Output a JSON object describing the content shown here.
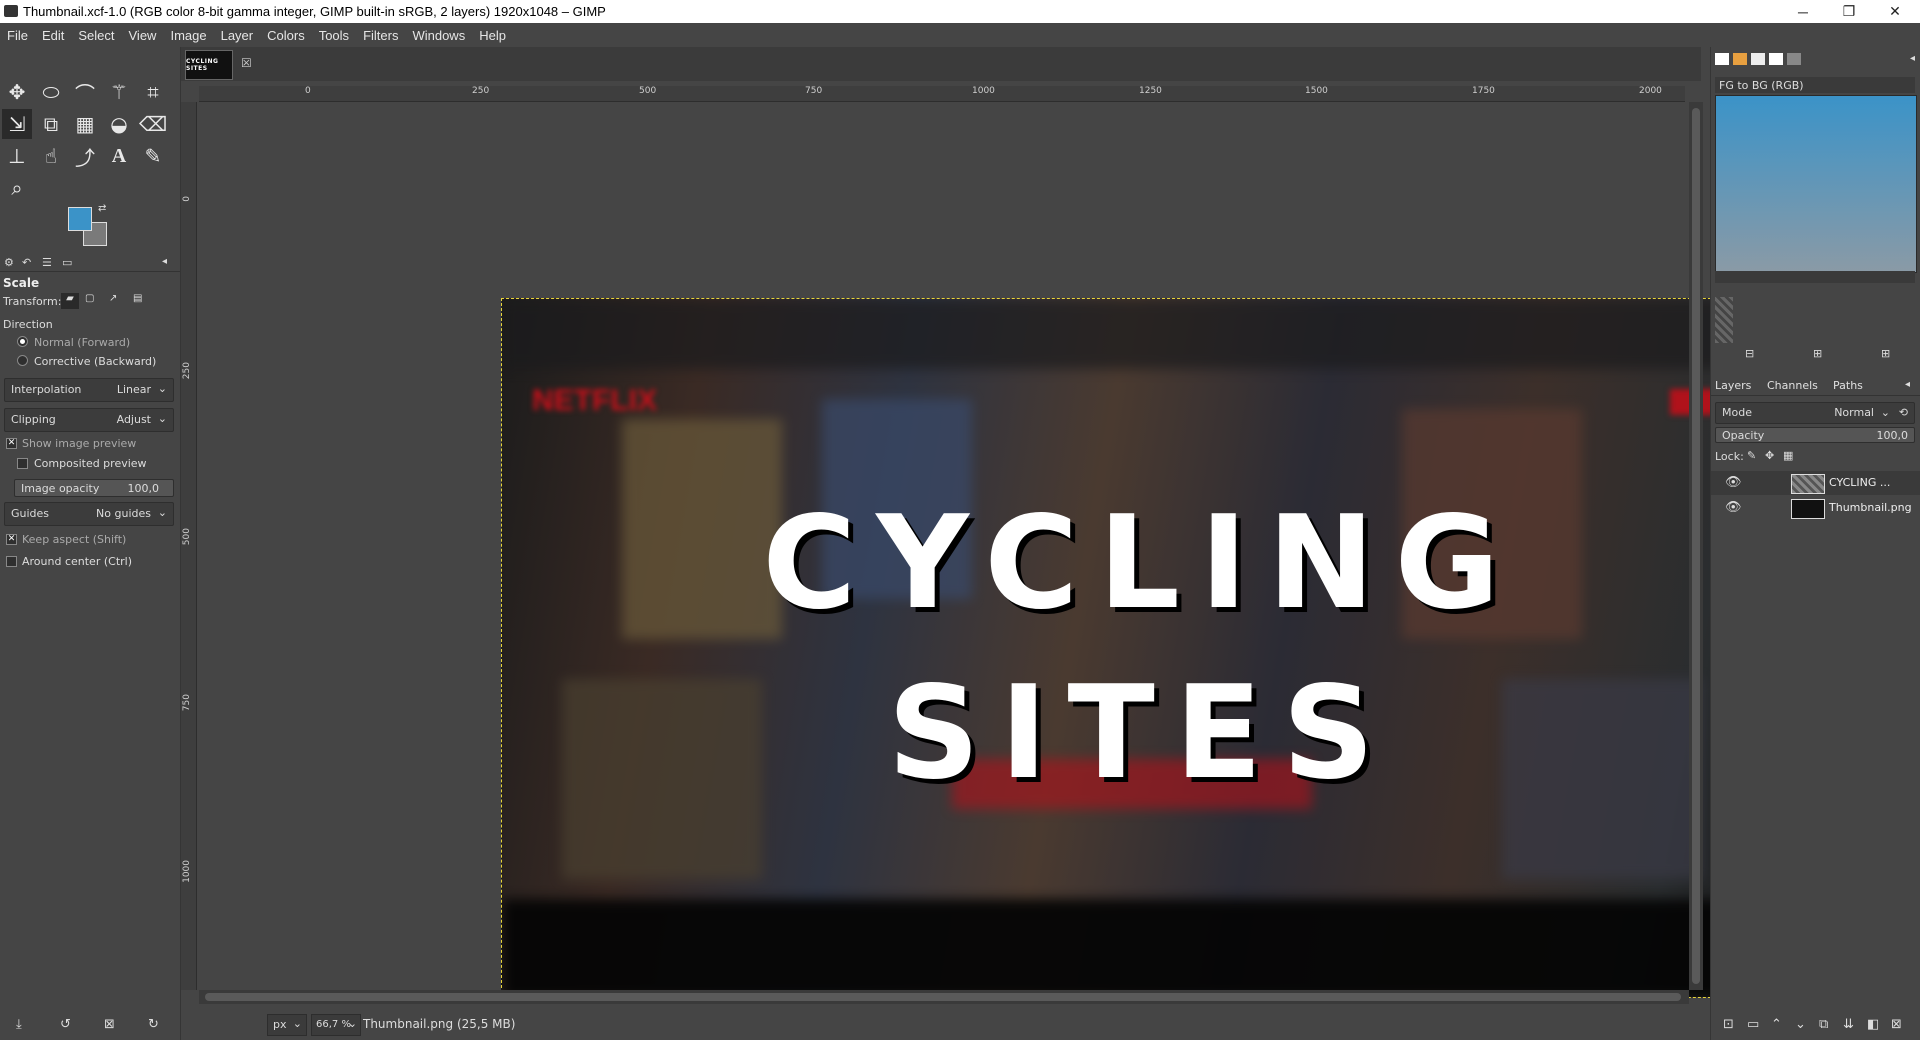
{
  "window": {
    "title": "Thumbnail.xcf-1.0 (RGB color 8-bit gamma integer, GIMP built-in sRGB, 2 layers) 1920x1048 – GIMP",
    "minimize": "─",
    "restore": "❐",
    "close": "✕"
  },
  "menu": [
    "File",
    "Edit",
    "Select",
    "View",
    "Image",
    "Layer",
    "Colors",
    "Tools",
    "Filters",
    "Windows",
    "Help"
  ],
  "tool_options": {
    "title": "Scale",
    "transform_label": "Transform:",
    "direction_label": "Direction",
    "direction_normal": "Normal (Forward)",
    "direction_corrective": "Corrective (Backward)",
    "interpolation_label": "Interpolation",
    "interpolation_value": "Linear",
    "clipping_label": "Clipping",
    "clipping_value": "Adjust",
    "show_preview": "Show image preview",
    "composited_preview": "Composited preview",
    "image_opacity_label": "Image opacity",
    "image_opacity_value": "100,0",
    "guides_label": "Guides",
    "guides_value": "No guides",
    "keep_aspect": "Keep aspect (Shift)",
    "around_center": "Around center (Ctrl)"
  },
  "colors": {
    "fg": "#3b93c8",
    "bg": "#7a7a7a"
  },
  "image_tab": {
    "thumb_text": "CYCLING SITES"
  },
  "ruler": {
    "h": [
      "0",
      "250",
      "500",
      "750",
      "1000",
      "1250",
      "1500",
      "1750",
      "2000"
    ],
    "v": [
      "0",
      "250",
      "500",
      "750",
      "1000"
    ]
  },
  "canvas": {
    "line1": "CYCLING",
    "line2": "SITES",
    "bg_logo": "NETFLIX"
  },
  "status": {
    "unit": "px",
    "zoom": "66,7 %",
    "text": "Thumbnail.png (25,5 MB)"
  },
  "gradient": {
    "name": "FG to BG (RGB)"
  },
  "layers_panel": {
    "tabs": [
      "Layers",
      "Channels",
      "Paths"
    ],
    "mode_label": "Mode",
    "mode_value": "Normal",
    "opacity_label": "Opacity",
    "opacity_value": "100,0",
    "lock_label": "Lock:",
    "layers": [
      {
        "name": "CYCLING ...",
        "visible": true
      },
      {
        "name": "Thumbnail.png",
        "visible": true
      }
    ]
  }
}
